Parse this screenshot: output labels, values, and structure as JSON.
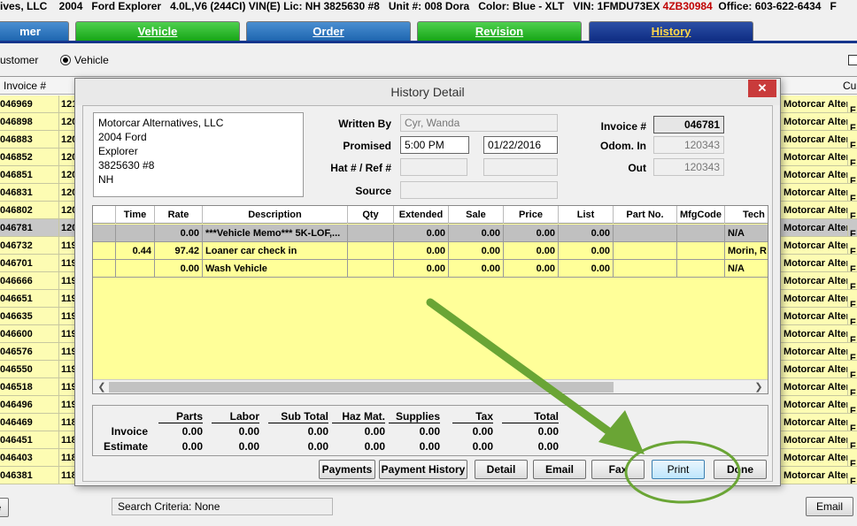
{
  "topbar": {
    "text_main": "ives, LLC    2004   Ford Explorer   4.0L,V6 (244CI) VIN(E) Lic: NH 3825630 #8   Unit #: 008 Dora   Color: Blue - XLT   VIN: 1FMDU73EX ",
    "vin_tail": "4ZB30984",
    "office": "  Office: 603-622-6434   F"
  },
  "tabs": [
    {
      "label": "mer"
    },
    {
      "label": "Vehicle"
    },
    {
      "label": "Order"
    },
    {
      "label": "Revision"
    },
    {
      "label": "History"
    }
  ],
  "radios": {
    "customer": "ustomer",
    "vehicle": "Vehicle"
  },
  "grid": {
    "col_invoice": "Invoice #",
    "col_cust": "Cu",
    "invoices": [
      "046969",
      "046898",
      "046883",
      "046852",
      "046851",
      "046831",
      "046802",
      "046781",
      "046732",
      "046701",
      "046666",
      "046651",
      "046635",
      "046600",
      "046576",
      "046550",
      "046518",
      "046496",
      "046469",
      "046451",
      "046403",
      "046381"
    ],
    "second": [
      "121",
      "120",
      "120",
      "120",
      "120",
      "120",
      "120",
      "120",
      "119",
      "119",
      "119",
      "119",
      "119",
      "119",
      "119",
      "119",
      "119",
      "119",
      "118",
      "118",
      "118",
      "118"
    ],
    "customer": "Motorcar Altern",
    "last_col": "F"
  },
  "bottom": {
    "left_btn": "e",
    "criteria": "Search Criteria: None",
    "email": "Email"
  },
  "dialog": {
    "title": "History Detail",
    "close": "✕",
    "address": [
      "Motorcar Alternatives, LLC",
      "2004 Ford",
      "Explorer",
      "3825630 #8",
      "NH"
    ],
    "written_by_label": "Written By",
    "written_by": "Cyr, Wanda",
    "promised_label": "Promised",
    "promised_time": "5:00 PM",
    "promised_date": "01/22/2016",
    "hat_label": "Hat # / Ref #",
    "source_label": "Source",
    "invoice_label": "Invoice #",
    "invoice": "046781",
    "odom_label": "Odom. In",
    "odom_in": "120343",
    "out_label": "Out",
    "odom_out": "120343",
    "cols": [
      "Time",
      "Rate",
      "Description",
      "Qty",
      "Extended",
      "Sale",
      "Price",
      "List",
      "Part No.",
      "MfgCode",
      "Tech"
    ],
    "rows": [
      {
        "time": "",
        "rate": "0.00",
        "desc": "***Vehicle Memo***  5K-LOF,...",
        "qty": "",
        "ext": "0.00",
        "sale": "0.00",
        "price": "0.00",
        "list": "0.00",
        "part": "",
        "mfg": "",
        "tech": "N/A"
      },
      {
        "time": "0.44",
        "rate": "97.42",
        "desc": "Loaner car check in",
        "qty": "",
        "ext": "0.00",
        "sale": "0.00",
        "price": "0.00",
        "list": "0.00",
        "part": "",
        "mfg": "",
        "tech": "Morin, R"
      },
      {
        "time": "",
        "rate": "0.00",
        "desc": "Wash Vehicle",
        "qty": "",
        "ext": "0.00",
        "sale": "0.00",
        "price": "0.00",
        "list": "0.00",
        "part": "",
        "mfg": "",
        "tech": "N/A"
      }
    ],
    "totals": {
      "headers": [
        "Parts",
        "Labor",
        "Sub Total",
        "Haz Mat.",
        "Supplies",
        "Tax",
        "Total"
      ],
      "invoice_label": "Invoice",
      "estimate_label": "Estimate",
      "invoice": [
        "0.00",
        "0.00",
        "0.00",
        "0.00",
        "0.00",
        "0.00",
        "0.00"
      ],
      "estimate": [
        "0.00",
        "0.00",
        "0.00",
        "0.00",
        "0.00",
        "0.00",
        "0.00"
      ]
    },
    "buttons": {
      "payments": "Payments",
      "payment_history": "Payment History",
      "detail": "Detail",
      "email": "Email",
      "fax": "Fax",
      "print": "Print",
      "done": "Done"
    }
  },
  "colors": {
    "annotation": "#6aa535",
    "row_yellow": "#ffff99",
    "active_tab": "#0d2a80"
  }
}
